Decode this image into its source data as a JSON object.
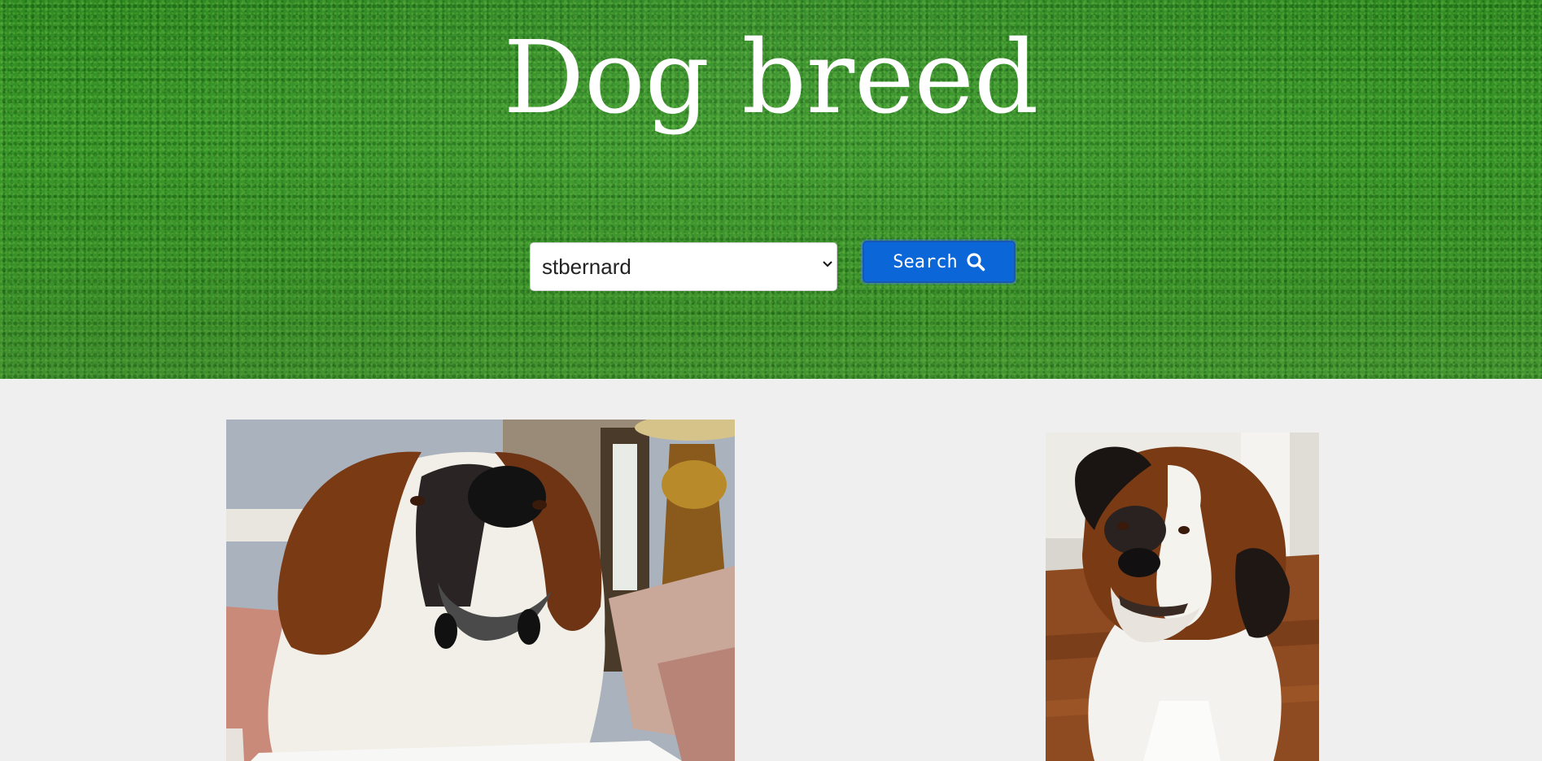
{
  "header": {
    "title": "Dog breed"
  },
  "search": {
    "selected_breed": "stbernard",
    "button_label": "Search",
    "button_icon": "search-icon"
  },
  "colors": {
    "button_bg": "#0b66d8",
    "page_bg": "#efefef",
    "grass": "#3a9a2a"
  },
  "gallery": {
    "images": [
      {
        "subject": "St. Bernard lying on a sofa"
      },
      {
        "subject": "St. Bernard sitting on a wooden floor"
      }
    ]
  }
}
